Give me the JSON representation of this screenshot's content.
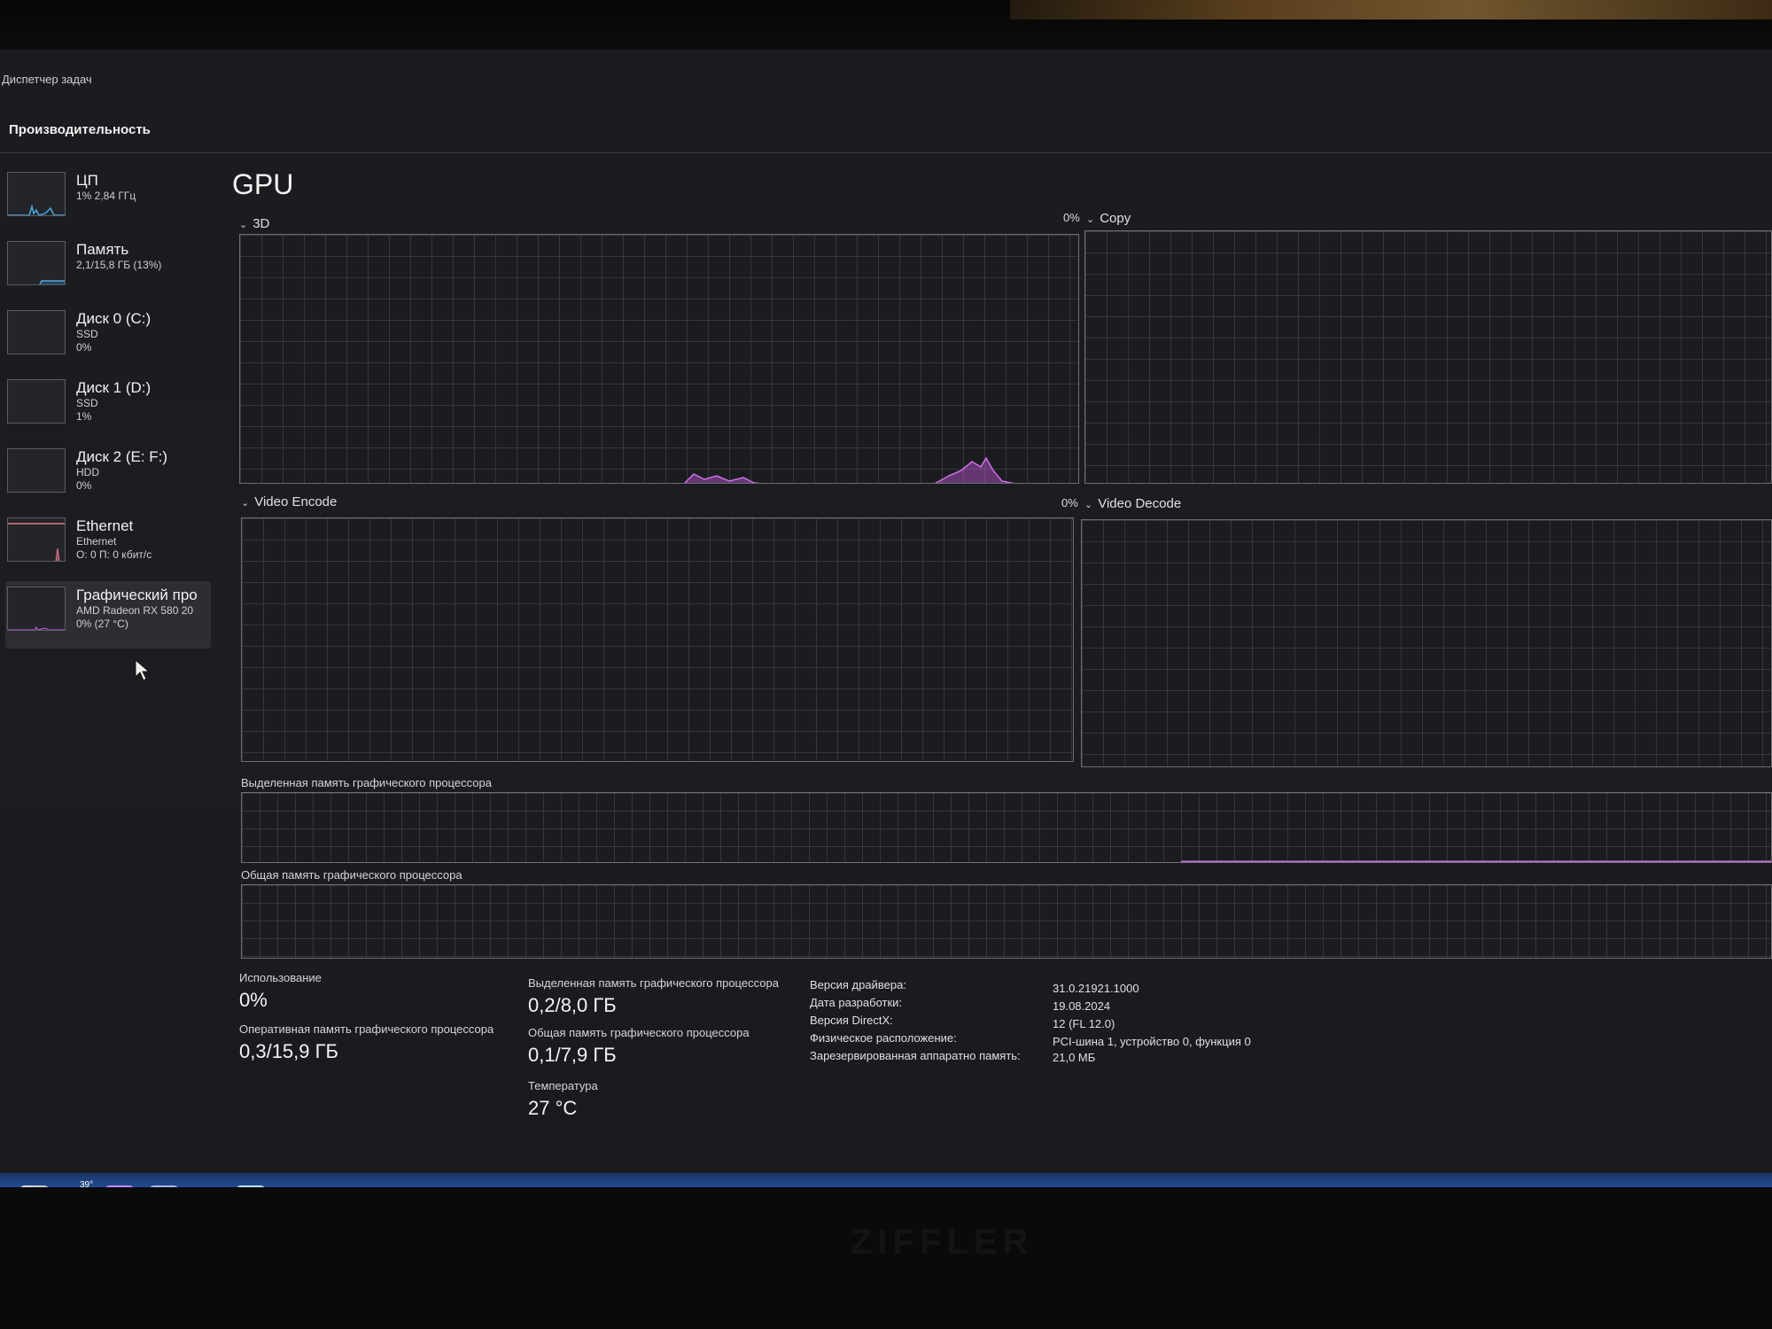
{
  "window": {
    "title": "Диспетчер задач"
  },
  "page": {
    "header": "Производительность"
  },
  "sidebar": {
    "items": [
      {
        "title": "ЦП",
        "line1": "1% 2,84 ГГц",
        "line2": "",
        "active": false
      },
      {
        "title": "Память",
        "line1": "2,1/15,8 ГБ (13%)",
        "line2": "",
        "active": false
      },
      {
        "title": "Диск 0 (C:)",
        "line1": "SSD",
        "line2": "0%",
        "active": false
      },
      {
        "title": "Диск 1 (D:)",
        "line1": "SSD",
        "line2": "1%",
        "active": false
      },
      {
        "title": "Диск 2 (E: F:)",
        "line1": "HDD",
        "line2": "0%",
        "active": false
      },
      {
        "title": "Ethernet",
        "line1": "Ethernet",
        "line2": "О: 0 П: 0 кбит/с",
        "active": false
      },
      {
        "title": "Графический про",
        "line1": "AMD Radeon RX 580 20",
        "line2": "0% (27 °C)",
        "active": true
      }
    ]
  },
  "gpu": {
    "title": "GPU",
    "charts": {
      "3d": {
        "label": "3D",
        "pct": "0%"
      },
      "copy": {
        "label": "Copy"
      },
      "video_encode": {
        "label": "Video Encode",
        "pct": "0%"
      },
      "video_decode": {
        "label": "Video Decode"
      }
    },
    "dedicated_memory_label": "Выделенная память графического процессора",
    "shared_memory_label": "Общая память графического процессора",
    "stats": {
      "usage_label": "Использование",
      "usage_value": "0%",
      "gpu_ram_label": "Оперативная память графического процессора",
      "gpu_ram_value": "0,3/15,9 ГБ",
      "dedicated_label": "Выделенная память графического процессора",
      "dedicated_value": "0,2/8,0 ГБ",
      "shared_label": "Общая память графического процессора",
      "shared_value": "0,1/7,9 ГБ",
      "temperature_label": "Температура",
      "temperature_value": "27 °C"
    },
    "info": [
      {
        "key": "Версия драйвера:",
        "value": "31.0.21921.1000"
      },
      {
        "key": "Дата разработки:",
        "value": "19.08.2024"
      },
      {
        "key": "Версия DirectX:",
        "value": "12 (FL 12.0)"
      },
      {
        "key": "Физическое расположение:",
        "value": "PCI-шина 1, устройство 0, функция 0"
      },
      {
        "key": "Зарезервированная аппаратно память:",
        "value": "21,0 МБ"
      }
    ]
  },
  "taskbar": {
    "icons": [
      "file-explorer-icon",
      "weather-icon",
      "premiere-pro-icon",
      "notes-app-icon",
      "green-app-icon",
      "task-manager-icon"
    ],
    "weather_temp": "39°"
  },
  "monitor": {
    "brand": "ZIFFLER"
  },
  "colors": {
    "accent_gpu": "#c058d8",
    "screen_bg": "#1b1c20",
    "grid": "#6c6e74"
  }
}
